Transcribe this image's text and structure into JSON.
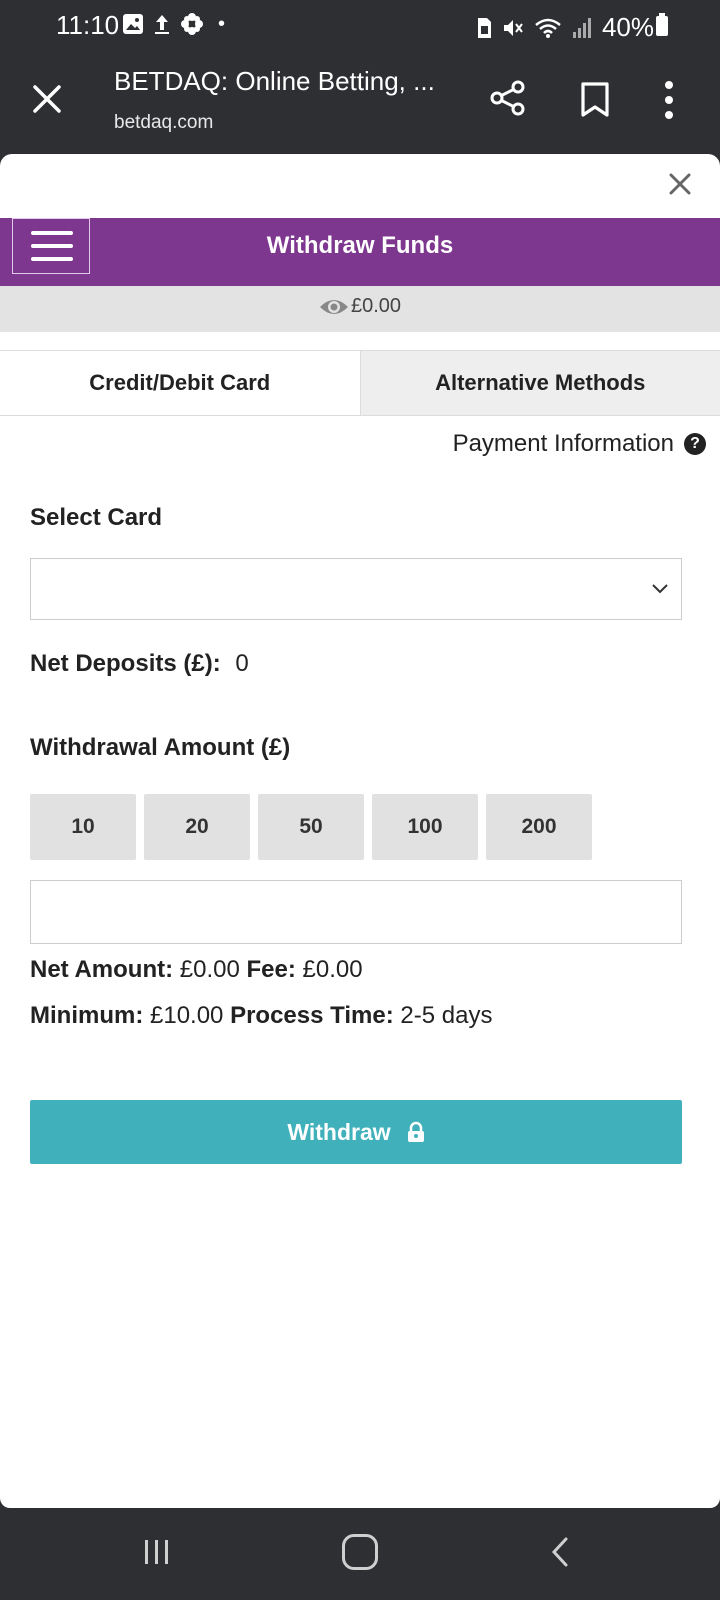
{
  "status_bar": {
    "time": "11:10",
    "battery": "40%"
  },
  "browser": {
    "page_title": "BETDAQ: Online Betting, ...",
    "url": "betdaq.com"
  },
  "header": {
    "title": "Withdraw Funds",
    "balance": "£0.00"
  },
  "tabs": [
    {
      "label": "Credit/Debit Card"
    },
    {
      "label": "Alternative Methods"
    }
  ],
  "payment_info_label": "Payment Information",
  "select_card": {
    "label": "Select Card",
    "value": ""
  },
  "net_deposits": {
    "label": "Net Deposits (£):",
    "value": "0"
  },
  "withdrawal": {
    "label": "Withdrawal Amount (£)",
    "amounts": [
      "10",
      "20",
      "50",
      "100",
      "200"
    ],
    "input_value": ""
  },
  "summary": {
    "net_amount_label": "Net Amount:",
    "net_amount_value": "£0.00",
    "fee_label": "Fee:",
    "fee_value": "£0.00",
    "minimum_label": "Minimum:",
    "minimum_value": "£10.00",
    "process_time_label": "Process Time:",
    "process_time_value": "2-5 days"
  },
  "withdraw_button": {
    "label": "Withdraw"
  },
  "colors": {
    "header_purple": "#7e378f",
    "withdraw_teal": "#40b1bb",
    "system_bar": "#2e2f33"
  }
}
